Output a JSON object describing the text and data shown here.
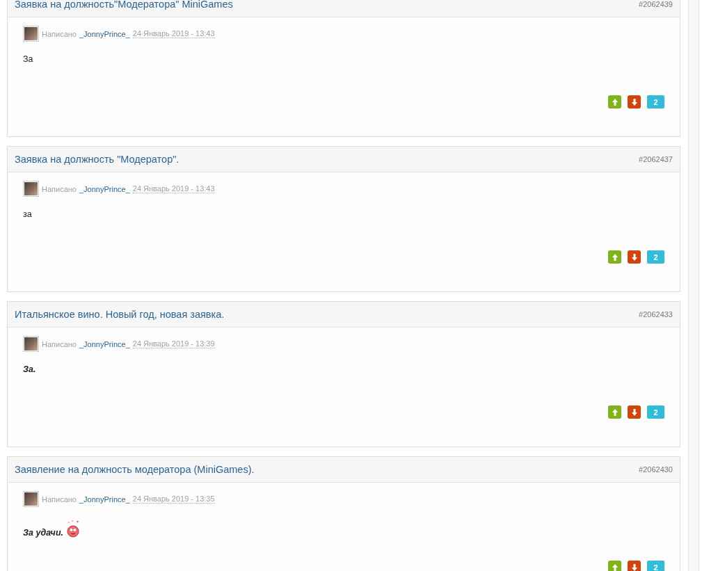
{
  "posts": [
    {
      "title": "Заявка на должность\"Модератора\" MiniGames",
      "number": "#2062439",
      "written": "Написано",
      "author": "_JonnyPrince_",
      "date": "24 Январь 2019 - 13:43",
      "body": "За",
      "emphasis": false,
      "smiley": false,
      "count": "2"
    },
    {
      "title": "Заявка на должность \"Модератор\".",
      "number": "#2062437",
      "written": "Написано",
      "author": "_JonnyPrince_",
      "date": "24 Январь 2019 - 13:43",
      "body": "за",
      "emphasis": false,
      "smiley": false,
      "count": "2"
    },
    {
      "title": "Итальянское вино. Новый год, новая заявка.",
      "number": "#2062433",
      "written": "Написано",
      "author": "_JonnyPrince_",
      "date": "24 Январь 2019 - 13:39",
      "body": "За.",
      "emphasis": true,
      "smiley": false,
      "count": "2"
    },
    {
      "title": "Заявление на должность модератора (MiniGames).",
      "number": "#2062430",
      "written": "Написано",
      "author": "_JonnyPrince_",
      "date": "24 Январь 2019 - 13:35",
      "body": "За удачи.",
      "emphasis": true,
      "smiley": true,
      "count": "2"
    }
  ]
}
